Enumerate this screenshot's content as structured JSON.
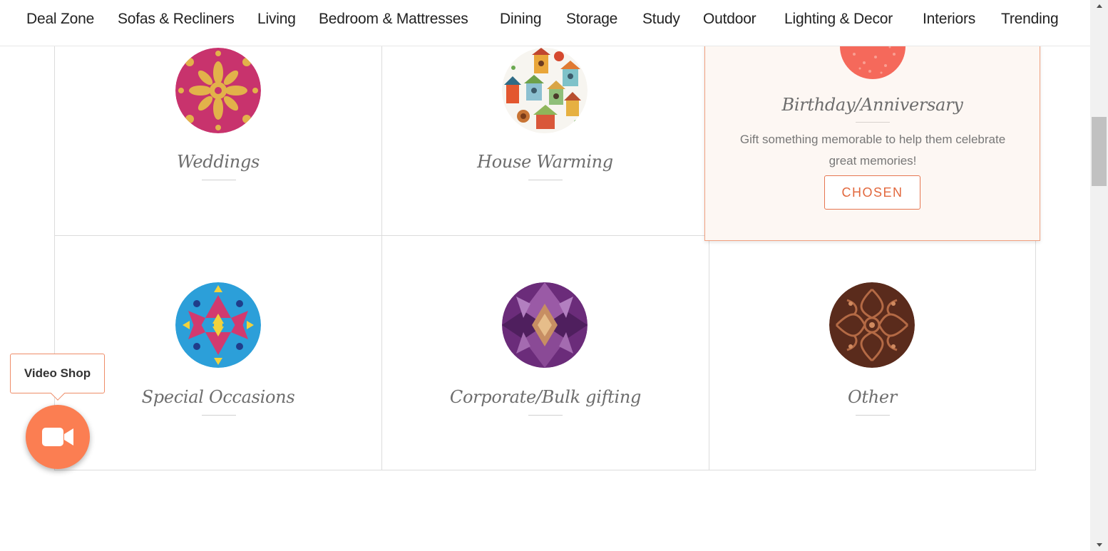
{
  "nav": {
    "items": [
      {
        "label": "Deal Zone"
      },
      {
        "label": "Sofas & Recliners"
      },
      {
        "label": "Living"
      },
      {
        "label": "Bedroom & Mattresses"
      },
      {
        "label": "Dining"
      },
      {
        "label": "Storage"
      },
      {
        "label": "Study"
      },
      {
        "label": "Outdoor"
      },
      {
        "label": "Lighting & Decor"
      },
      {
        "label": "Interiors"
      },
      {
        "label": "Trending"
      }
    ]
  },
  "occasions": {
    "weddings": {
      "title": "Weddings",
      "icon": "mandala-pink-gold-icon"
    },
    "house_warming": {
      "title": "House Warming",
      "icon": "birdhouses-icon"
    },
    "birthday": {
      "title": "Birthday/Anniversary",
      "description": "Gift something memorable to help them celebrate great memories!",
      "button_label": "CHOSEN",
      "icon": "coral-pattern-icon"
    },
    "special": {
      "title": "Special Occasions",
      "icon": "kaleidoscope-blue-icon"
    },
    "corporate": {
      "title": "Corporate/Bulk gifting",
      "icon": "kaleidoscope-purple-icon"
    },
    "other": {
      "title": "Other",
      "icon": "copper-pattern-icon"
    }
  },
  "video_shop": {
    "label": "Video Shop",
    "icon": "video-camera-icon"
  },
  "colors": {
    "accent": "#fb7e52",
    "chosen_border": "#f1a07f",
    "chosen_text": "#e2683d",
    "featured_bg": "#fdf7f3"
  }
}
